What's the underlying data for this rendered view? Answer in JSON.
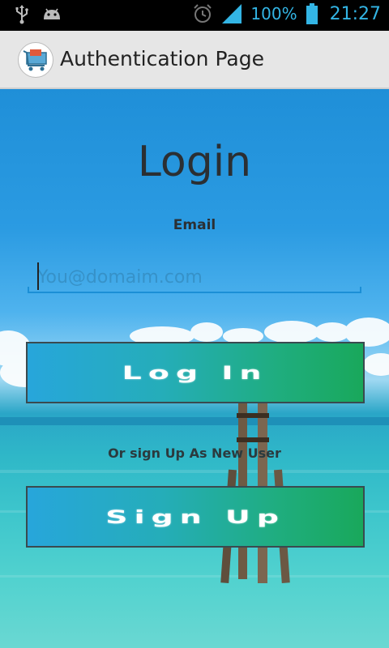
{
  "status_bar": {
    "battery_percent": "100%",
    "time": "21:27",
    "icons": [
      "usb-icon",
      "android-debug-icon",
      "alarm-icon",
      "signal-icon",
      "battery-icon"
    ]
  },
  "action_bar": {
    "title": "Authentication Page",
    "icon": "shopping-cart-app-icon"
  },
  "login": {
    "title": "Login",
    "email_label": "Email",
    "email_placeholder": "You@domaim.com",
    "email_value": "",
    "login_button": "Log In",
    "or_text": "Or sign Up As New User",
    "signup_button": "Sign Up"
  },
  "colors": {
    "accent": "#33b5e5",
    "button_left": "#27a6db",
    "button_right": "#19a85b",
    "underline": "#1b8fd6"
  }
}
